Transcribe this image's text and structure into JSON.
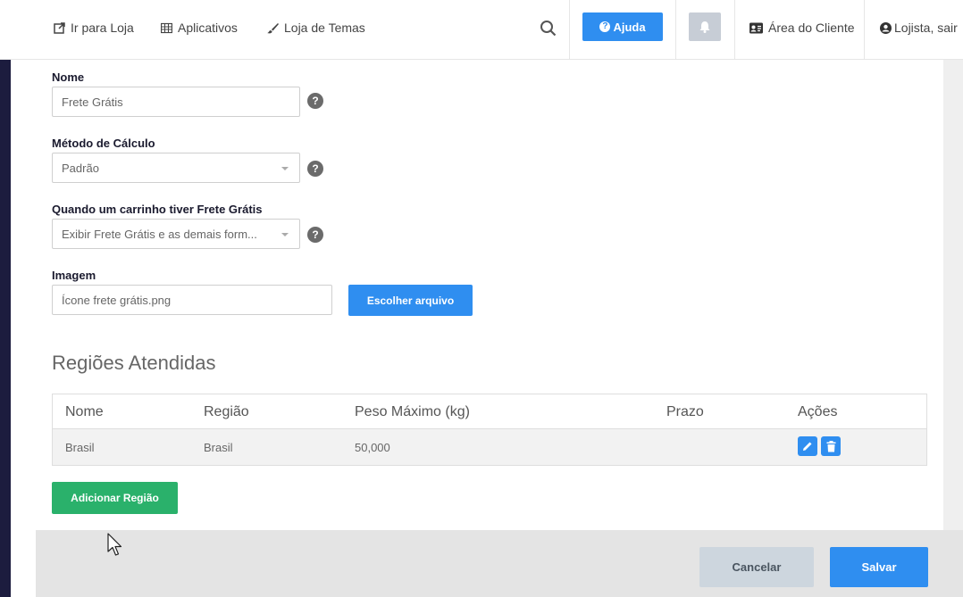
{
  "topbar": {
    "store_link": "Ir para Loja",
    "apps_link": "Aplicativos",
    "themes_link": "Loja de Temas",
    "help_label": "Ajuda",
    "client_area": "Área do Cliente",
    "logout": "Lojista, sair"
  },
  "form": {
    "name_label": "Nome",
    "name_value": "Frete Grátis",
    "method_label": "Método de Cálculo",
    "method_value": "Padrão",
    "cart_label": "Quando um carrinho tiver Frete Grátis",
    "cart_value": "Exibir Frete Grátis e as demais form...",
    "image_label": "Imagem",
    "image_value": "Ícone frete grátis.png",
    "choose_file": "Escolher arquivo"
  },
  "regions": {
    "title": "Regiões Atendidas",
    "columns": [
      "Nome",
      "Região",
      "Peso Máximo (kg)",
      "Prazo",
      "Ações"
    ],
    "rows": [
      {
        "nome": "Brasil",
        "regiao": "Brasil",
        "peso": "50,000",
        "prazo": ""
      }
    ],
    "add_button": "Adicionar Região"
  },
  "footer": {
    "cancel": "Cancelar",
    "save": "Salvar"
  },
  "colors": {
    "primary": "#2f8ef0",
    "success": "#2ab16b",
    "sidebar": "#1c1c3e",
    "cancel_bg": "#cdd6de"
  }
}
